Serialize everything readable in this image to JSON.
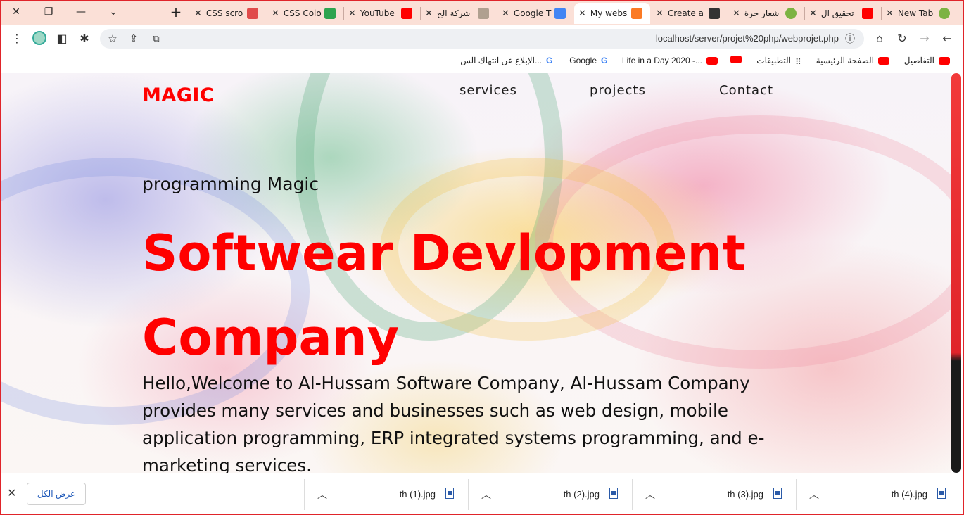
{
  "browser": {
    "tabs": [
      {
        "title": "CSS scro",
        "icon": "css-icon",
        "color": "#e04b4b"
      },
      {
        "title": "CSS Colo",
        "icon": "w3-icon",
        "color": "#2ea44f"
      },
      {
        "title": "YouTube",
        "icon": "youtube-icon",
        "color": "#ff0000"
      },
      {
        "title": "شركة الح",
        "icon": "site-icon",
        "color": "#888888"
      },
      {
        "title": "Google T",
        "icon": "google-translate-icon",
        "color": "#4285f4"
      },
      {
        "title": "My webs",
        "icon": "xampp-icon",
        "color": "#fb7a24",
        "active": true
      },
      {
        "title": "Create a",
        "icon": "shield-icon",
        "color": "#333333"
      },
      {
        "title": "شعار حرة",
        "icon": "chrome-icon",
        "color": "#7cb342"
      },
      {
        "title": "تحقيق ال",
        "icon": "youtube-icon",
        "color": "#ff0000"
      },
      {
        "title": "New Tab",
        "icon": "chrome-icon",
        "color": "#7cb342"
      }
    ],
    "address": {
      "url": "localhost/server/projet%20php/webprojet.php"
    },
    "bookmarks": [
      {
        "label": "التفاصيل",
        "icon": "youtube-icon"
      },
      {
        "label": "الصفحة الرئيسية",
        "icon": "youtube-icon"
      },
      {
        "label": "التطبيقات",
        "icon": "apps-icon"
      },
      {
        "label": "",
        "icon": "youtube-icon"
      },
      {
        "label": "Life in a Day 2020 -...",
        "icon": "youtube-icon"
      },
      {
        "label": "Google",
        "icon": "google-icon"
      },
      {
        "label": "الإبلاغ عن انتهاك الس...",
        "icon": "google-icon"
      }
    ]
  },
  "site": {
    "logo": "MAGIC",
    "nav": {
      "services": "services",
      "projects": "projects",
      "contact": "Contact"
    },
    "kicker": "programming Magic",
    "headline_line1": "Softwear Devlopment",
    "headline_line2": "Company",
    "intro": "Hello,Welcome to Al-Hussam Software Company, Al-Hussam Company provides many services and businesses such as web design, mobile application programming, ERP integrated systems programming, and e-marketing services."
  },
  "downloads": {
    "show_all": "عرض الكل",
    "files": [
      "th (1).jpg",
      "th (2).jpg",
      "th (3).jpg",
      "th (4).jpg"
    ]
  },
  "colors": {
    "accent": "#ff0000",
    "tabstrip": "#fbe0d7",
    "frame": "#e0242a"
  }
}
